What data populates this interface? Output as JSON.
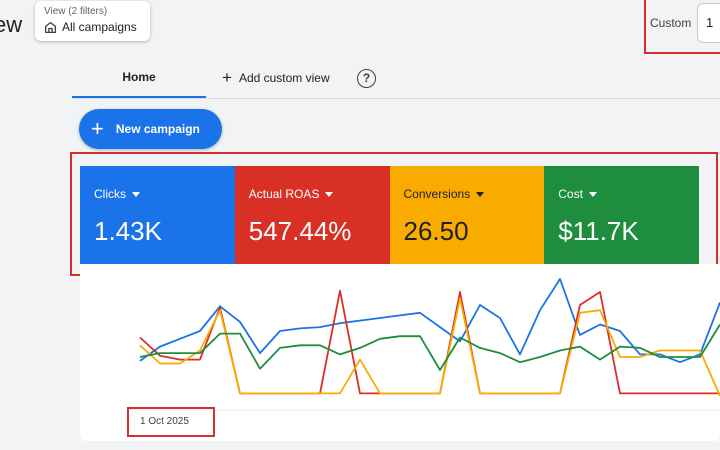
{
  "header": {
    "title_fragment": "ew",
    "view_selector": {
      "caption": "View (2 filters)",
      "value": "All campaigns"
    },
    "date_range": {
      "label": "Custom",
      "value": "1"
    }
  },
  "tabs": {
    "home": "Home",
    "add_custom_view": "Add custom view",
    "help_glyph": "?"
  },
  "new_campaign_label": "New campaign",
  "kpis": [
    {
      "label": "Clicks",
      "value": "1.43K",
      "color": "#1a73e8"
    },
    {
      "label": "Actual ROAS",
      "value": "547.44%",
      "color": "#d93025"
    },
    {
      "label": "Conversions",
      "value": "26.50",
      "color": "#f9ab00"
    },
    {
      "label": "Cost",
      "value": "$11.7K",
      "color": "#1e8e3e"
    }
  ],
  "chart_data": {
    "type": "line",
    "x_start_label": "1 Oct 2025",
    "ylim": [
      0,
      100
    ],
    "series": [
      {
        "color": "#1a73e8",
        "values": [
          37,
          48,
          54,
          60,
          79,
          67,
          43,
          60,
          62,
          63,
          66,
          68,
          70,
          72,
          74,
          63,
          52,
          80,
          70,
          42,
          76,
          100,
          57,
          65,
          60,
          42,
          42,
          36,
          42,
          82
        ]
      },
      {
        "color": "#d93025",
        "values": [
          55,
          41,
          38,
          38,
          78,
          12,
          12,
          12,
          12,
          12,
          91,
          12,
          12,
          12,
          12,
          12,
          90,
          12,
          12,
          12,
          12,
          12,
          80,
          90,
          12,
          12,
          12,
          12,
          12,
          12
        ]
      },
      {
        "color": "#f9ab00",
        "values": [
          49,
          35,
          35,
          45,
          76,
          12,
          12,
          12,
          12,
          12,
          12,
          38,
          12,
          12,
          12,
          12,
          85,
          12,
          12,
          12,
          12,
          12,
          74,
          76,
          40,
          40,
          45,
          45,
          45,
          10
        ]
      },
      {
        "color": "#1e8e3e",
        "values": [
          40,
          43,
          43,
          43,
          58,
          58,
          31,
          47,
          49,
          49,
          42,
          47,
          54,
          56,
          56,
          30,
          55,
          47,
          43,
          36,
          40,
          45,
          48,
          38,
          48,
          47,
          40,
          40,
          40,
          65
        ]
      }
    ]
  }
}
